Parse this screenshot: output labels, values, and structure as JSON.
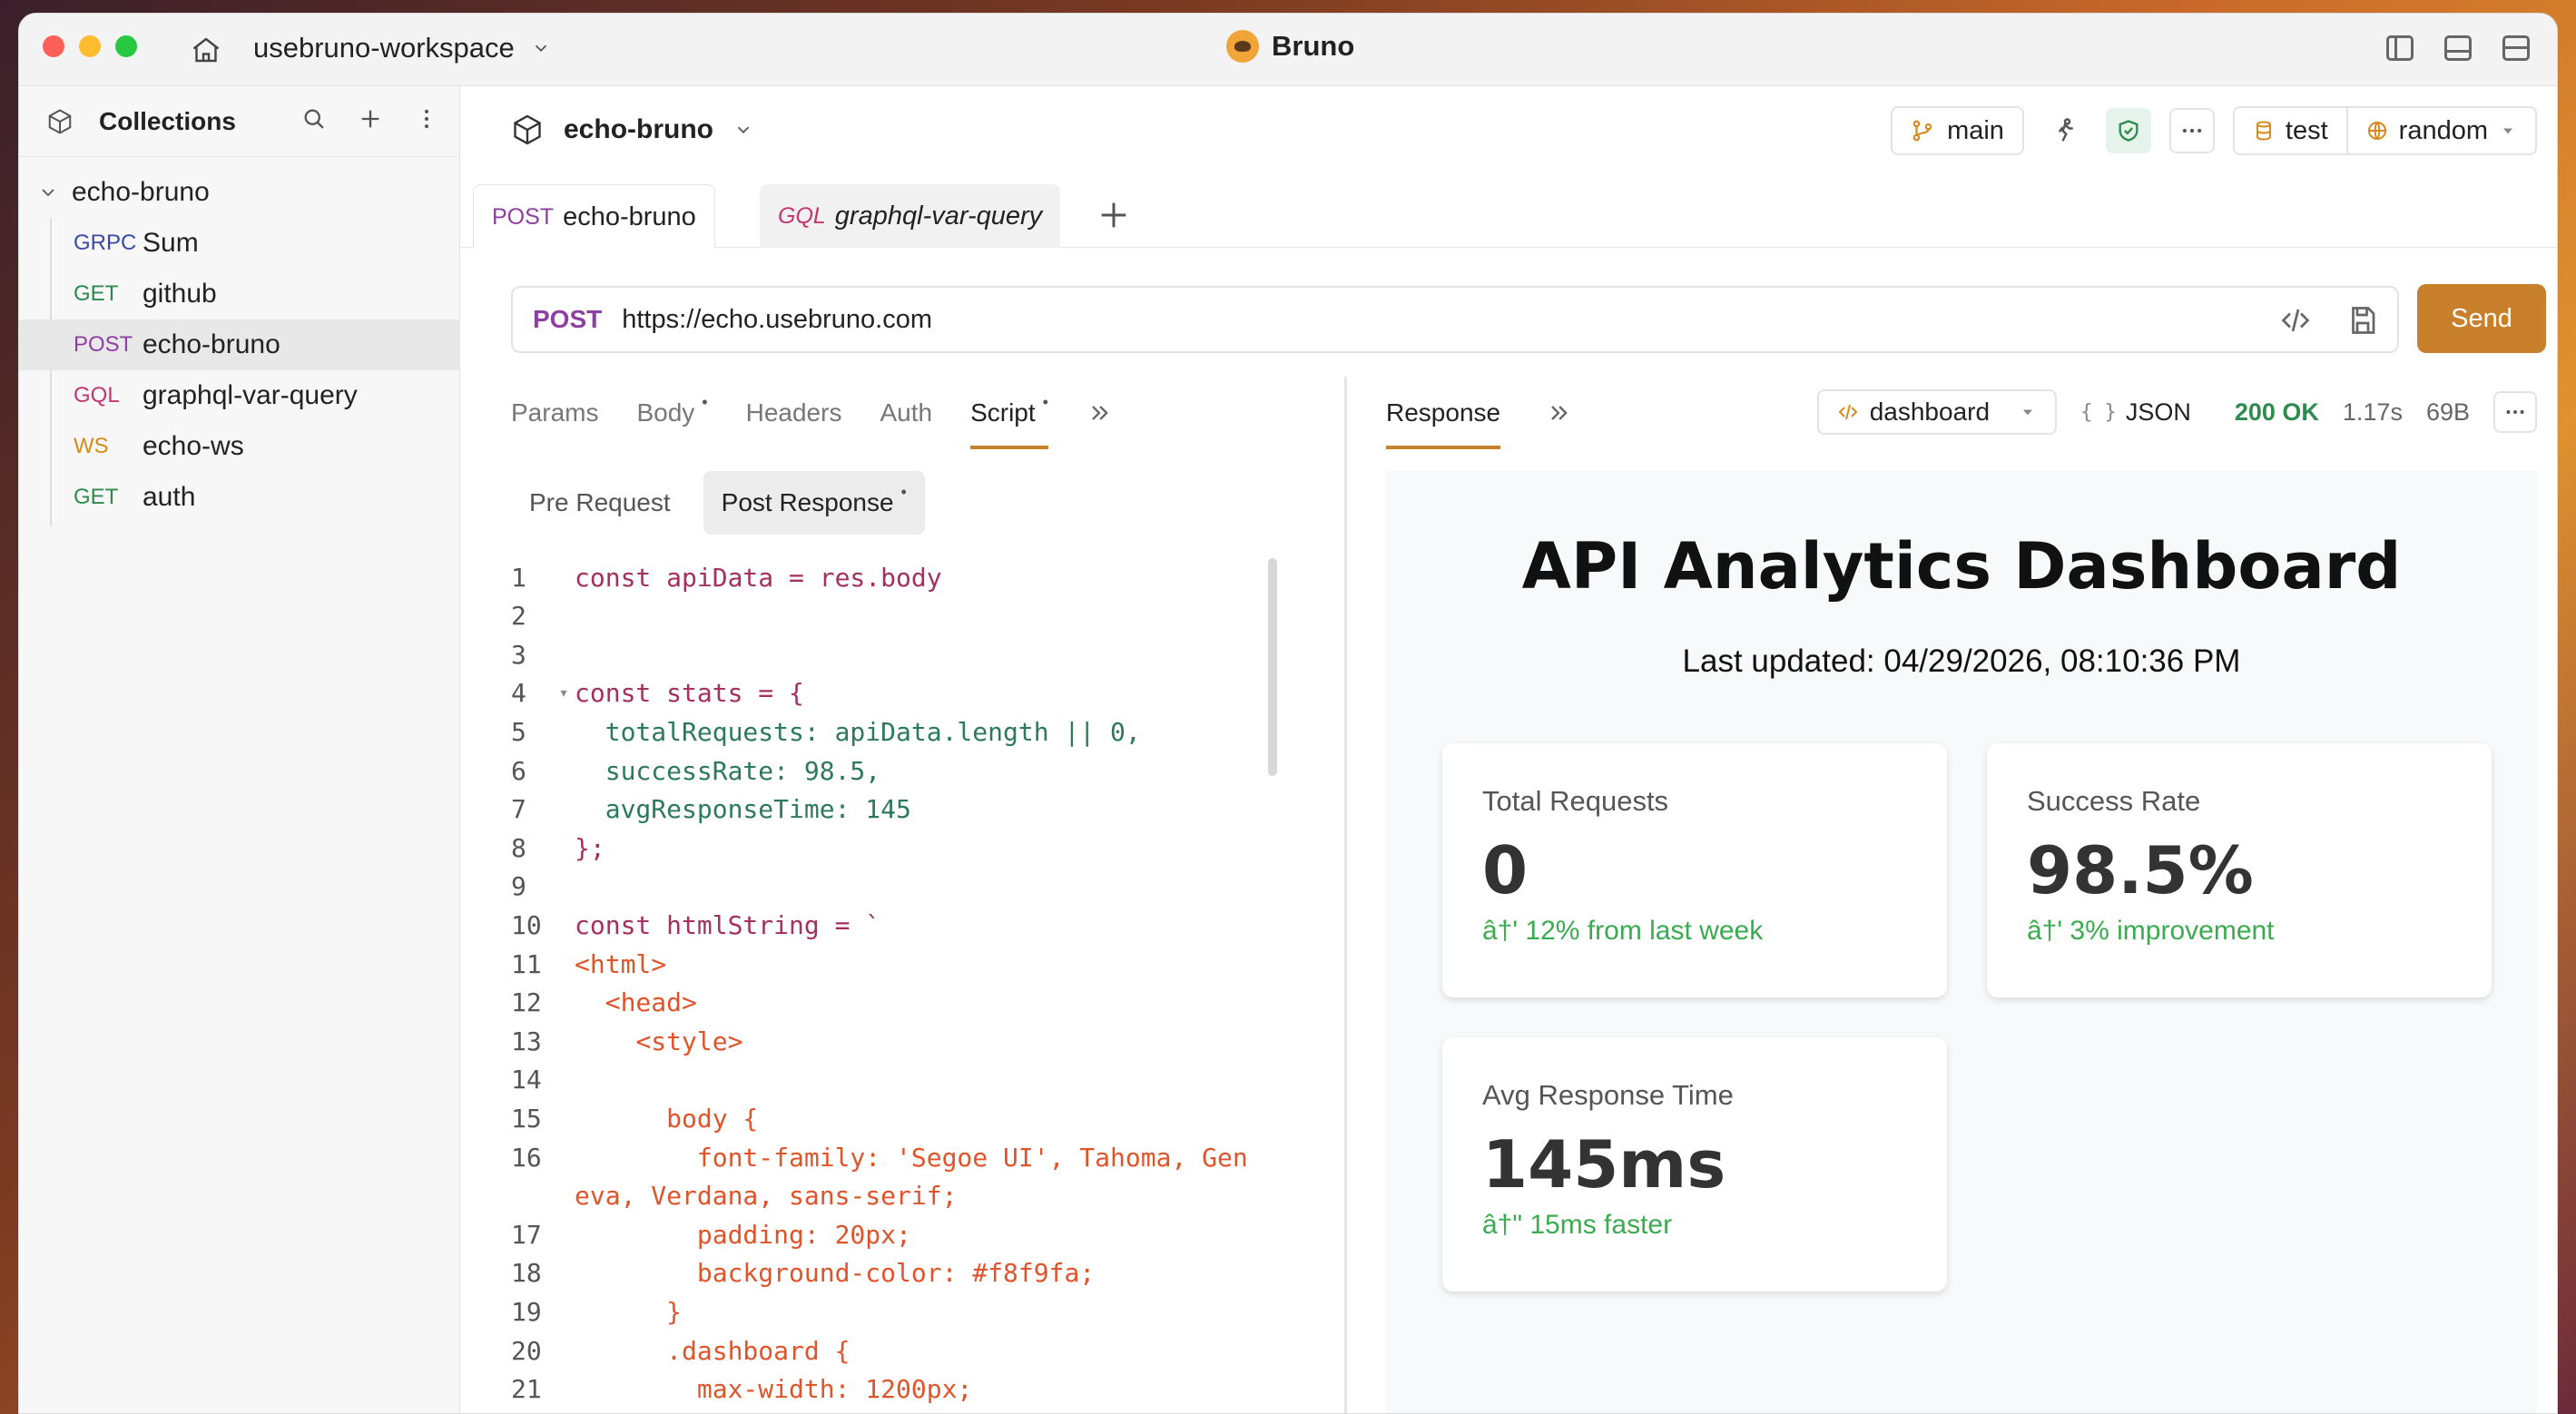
{
  "titlebar": {
    "workspace": "usebruno-workspace",
    "app_title": "Bruno"
  },
  "sidebar": {
    "title": "Collections",
    "root": "echo-bruno",
    "items": [
      {
        "method": "GRPC",
        "label": "Sum",
        "color": "#3b4aa8"
      },
      {
        "method": "GET",
        "label": "github",
        "color": "#2e8b4e"
      },
      {
        "method": "POST",
        "label": "echo-bruno",
        "color": "#8e3fa3"
      },
      {
        "method": "GQL",
        "label": "graphql-var-query",
        "color": "#c2376d"
      },
      {
        "method": "WS",
        "label": "echo-ws",
        "color": "#d8891c"
      },
      {
        "method": "GET",
        "label": "auth",
        "color": "#2e8b4e"
      }
    ]
  },
  "header": {
    "collection": "echo-bruno",
    "branch": "main",
    "env_collection": "test",
    "env_global": "random"
  },
  "tabs": [
    {
      "method": "POST",
      "label": "echo-bruno"
    },
    {
      "method": "GQL",
      "label": "graphql-var-query"
    }
  ],
  "url": {
    "method": "POST",
    "value": "https://echo.usebruno.com",
    "send_label": "Send"
  },
  "request_tabs": {
    "params": "Params",
    "body": "Body",
    "headers": "Headers",
    "auth": "Auth",
    "script": "Script",
    "dot": "•"
  },
  "script_tabs": {
    "pre": "Pre Request",
    "post": "Post Response"
  },
  "code_lines": [
    {
      "n": "1",
      "text": "const apiData = res.body"
    },
    {
      "n": "2",
      "text": ""
    },
    {
      "n": "3",
      "text": ""
    },
    {
      "n": "4",
      "text": "const stats = {"
    },
    {
      "n": "5",
      "text": "  totalRequests: apiData.length || 0,"
    },
    {
      "n": "6",
      "text": "  successRate: 98.5,"
    },
    {
      "n": "7",
      "text": "  avgResponseTime: 145"
    },
    {
      "n": "8",
      "text": "};"
    },
    {
      "n": "9",
      "text": ""
    },
    {
      "n": "10",
      "text": "const htmlString = `"
    },
    {
      "n": "11",
      "text": "<html>"
    },
    {
      "n": "12",
      "text": "  <head>"
    },
    {
      "n": "13",
      "text": "    <style>"
    },
    {
      "n": "14",
      "text": ""
    },
    {
      "n": "15",
      "text": "      body {"
    },
    {
      "n": "16",
      "text": "        font-family: 'Segoe UI', Tahoma, Gen"
    },
    {
      "n": "",
      "text": "eva, Verdana, sans-serif;"
    },
    {
      "n": "17",
      "text": "        padding: 20px;"
    },
    {
      "n": "18",
      "text": "        background-color: #f8f9fa;"
    },
    {
      "n": "19",
      "text": "      }"
    },
    {
      "n": "20",
      "text": "      .dashboard {"
    },
    {
      "n": "21",
      "text": "        max-width: 1200px;"
    }
  ],
  "response": {
    "tab": "Response",
    "view": "dashboard",
    "format": "JSON",
    "status": "200 OK",
    "time": "1.17s",
    "size": "69B"
  },
  "dashboard": {
    "title": "API Analytics Dashboard",
    "updated": "Last updated: 04/29/2026, 08:10:36 PM",
    "cards": [
      {
        "label": "Total Requests",
        "value": "0",
        "trend": "â†' 12% from last week"
      },
      {
        "label": "Success Rate",
        "value": "98.5%",
        "trend": "â†' 3% improvement"
      },
      {
        "label": "Avg Response Time",
        "value": "145ms",
        "trend": "â†\" 15ms faster"
      }
    ]
  }
}
